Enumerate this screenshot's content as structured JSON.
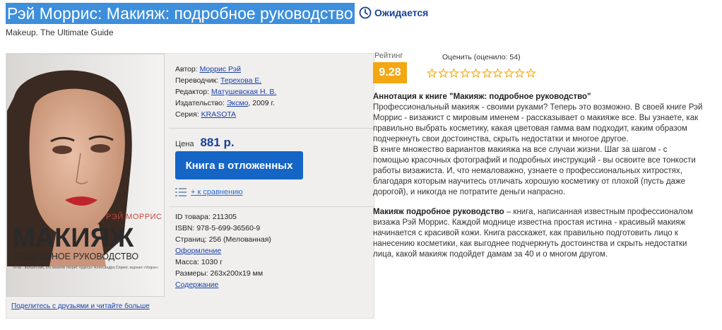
{
  "header": {
    "title": "Рэй Моррис: Макияж: подробное руководство",
    "status": "Ожидается",
    "subtitle": "Makeup. The Ultimate Guide"
  },
  "cover": {
    "author_line": "РЭЙ МОРРИС",
    "title_big": "МАКИЯЖ",
    "title_small": "ПОДРОБНОЕ РУКОВОДСТВО",
    "quote": "«Рэй - волшебник, его макияж творит чудеса» Александра Спринг, журнал «Vogue»"
  },
  "meta": {
    "author_label": "Автор:",
    "author": "Моррис Рэй",
    "translator_label": "Переводчик:",
    "translator": "Терехова Е.",
    "editor_label": "Редактор:",
    "editor": "Матушевская Н. В.",
    "publisher_label": "Издательство:",
    "publisher": "Эксмо",
    "year": ", 2009 г.",
    "series_label": "Серия:",
    "series": "KRASOTA"
  },
  "price": {
    "label": "Цена",
    "value": "881 р.",
    "button": "Книга в отложенных",
    "compare": "+ к сравнению"
  },
  "details": {
    "id": "ID товара: 211305",
    "isbn": "ISBN: 978-5-699-36560-9",
    "pages": "Страниц: 256 (Мелованная)",
    "design_link": "Оформление",
    "weight": "Масса: 1030 г",
    "size": "Размеры: 263x200x19 мм",
    "contents_link": "Содержание"
  },
  "share": "Поделитесь с друзьями и читайте больше",
  "rating": {
    "label": "Рейтинг",
    "value": "9.28",
    "rate_label": "Оценить (оценило: 54)",
    "stars_total": 10,
    "colors": {
      "badge": "#f3a712",
      "star": "#f3a712"
    }
  },
  "annotation": {
    "title": "Аннотация к книге \"Макияж: подробное руководство\"",
    "para1": "Профессиональный макияж - своими руками? Теперь это возможно. В своей книге Рэй Моррис - визажист с мировым именем - рассказывает о макияже все. Вы узнаете, как правильно выбрать косметику, какая цветовая гамма вам подходит, каким образом подчеркнуть свои достоинства, скрыть недостатки и многое другое.",
    "para2": "В книге множество вариантов макияжа на все случаи жизни. Шаг за шагом - с помощью красочных фотографий и подробных инструкций - вы освоите все тонкости работы визажиста. И, что немаловажно, узнаете о профессиональных хитростях, благодаря которым научитесь отличать хорошую косметику от плохой (пусть даже дорогой), и никогда не потратите деньги напрасно.",
    "bold_lead": "Макияж подробное руководство",
    "para3": " – книга, написанная известным профессионалом визажа Рэй Моррис. Каждой моднице известна простая истина - красивый макияж начинается с красивой кожи. Книга расскажет, как правильно подготовить лицо к нанесению косметики, как выгоднее подчеркнуть достоинства и скрыть недостатки лица, какой макияж подойдет дамам за 40 и о многом другом."
  }
}
